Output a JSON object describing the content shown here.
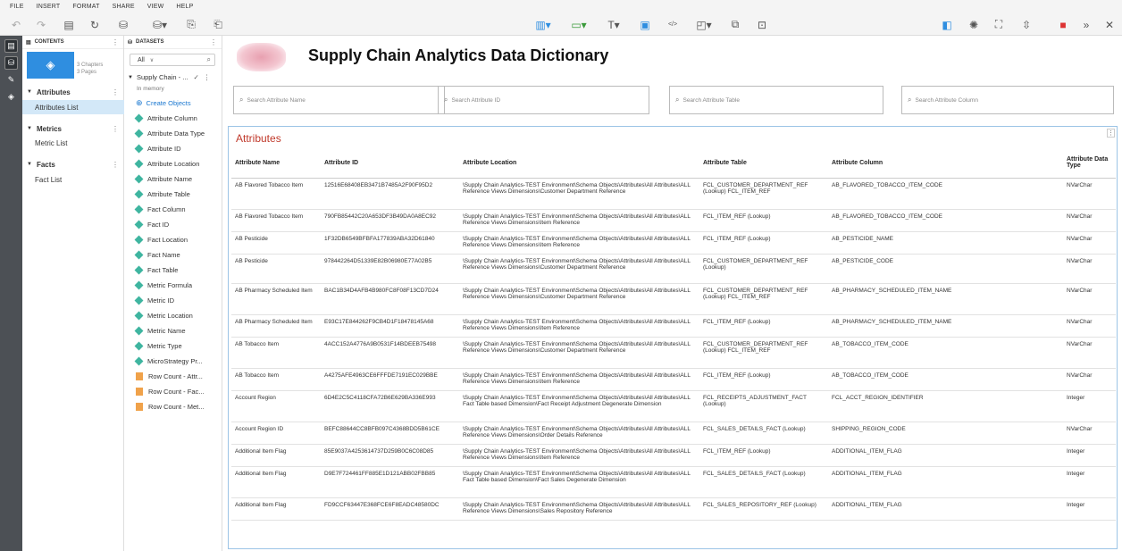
{
  "menu": [
    "FILE",
    "INSERT",
    "FORMAT",
    "SHARE",
    "VIEW",
    "HELP"
  ],
  "contents": {
    "header": "CONTENTS",
    "chapters_count": "3 Chapters",
    "pages_count": "3 Pages",
    "chapters": [
      {
        "label": "Attributes",
        "page": "Attributes List"
      },
      {
        "label": "Metrics",
        "page": "Metric List"
      },
      {
        "label": "Facts",
        "page": "Fact List"
      }
    ]
  },
  "datasets": {
    "header": "DATASETS",
    "filter": "All",
    "dataset_name": "Supply Chain - ...",
    "in_memory": "In memory",
    "create_objects": "Create Objects",
    "items": [
      "Attribute Column",
      "Attribute Data Type",
      "Attribute ID",
      "Attribute Location",
      "Attribute Name",
      "Attribute Table",
      "Fact Column",
      "Fact ID",
      "Fact Location",
      "Fact Name",
      "Fact Table",
      "Metric Formula",
      "Metric ID",
      "Metric Location",
      "Metric Name",
      "Metric Type",
      "MicroStrategy Pr..."
    ],
    "metric_items": [
      "Row Count - Attr...",
      "Row Count - Fac...",
      "Row Count - Met..."
    ]
  },
  "page": {
    "title": "Supply Chain Analytics Data Dictionary",
    "searches": [
      "Search Attribute Name",
      "Search Attribute ID",
      "Search Attribute Table",
      "Search Attribute Column"
    ]
  },
  "grid": {
    "title": "Attributes",
    "columns": [
      "Attribute Name",
      "Attribute ID",
      "Attribute Location",
      "Attribute Table",
      "Attribute Column",
      "Attribute Data Type"
    ],
    "rows": [
      [
        "AB Flavored Tobacco Item",
        "12516E68408EB3471B7485A2F90F95D2",
        "\\Supply Chain Analytics-TEST Environment\\Schema Objects\\Attributes\\All Attributes\\ALL Reference Views Dimensions\\Customer Department Reference",
        "FCL_CUSTOMER_DEPARTMENT_REF (Lookup) FCL_ITEM_REF",
        "AB_FLAVORED_TOBACCO_ITEM_CODE",
        "NVarChar"
      ],
      [
        "AB Flavored Tobacco Item",
        "790FB85442C20A653DF3B49DA0A8EC92",
        "\\Supply Chain Analytics-TEST Environment\\Schema Objects\\Attributes\\All Attributes\\ALL Reference Views Dimensions\\Item Reference",
        "FCL_ITEM_REF (Lookup)",
        "AB_FLAVORED_TOBACCO_ITEM_CODE",
        "NVarChar"
      ],
      [
        "AB Pesticide",
        "1F32DB6549BFBFA177839ABA32D61840",
        "\\Supply Chain Analytics-TEST Environment\\Schema Objects\\Attributes\\All Attributes\\ALL Reference Views Dimensions\\Item Reference",
        "FCL_ITEM_REF (Lookup)",
        "AB_PESTICIDE_NAME",
        "NVarChar"
      ],
      [
        "AB Pesticide",
        "978442264D51339E82B06980E77A02B5",
        "\\Supply Chain Analytics-TEST Environment\\Schema Objects\\Attributes\\All Attributes\\ALL Reference Views Dimensions\\Customer Department Reference",
        "FCL_CUSTOMER_DEPARTMENT_REF (Lookup)",
        "AB_PESTICIDE_CODE",
        "NVarChar"
      ],
      [
        "AB Pharmacy Scheduled Item",
        "BAC1B34D4AFB4B980FC8F08F13CD7D24",
        "\\Supply Chain Analytics-TEST Environment\\Schema Objects\\Attributes\\All Attributes\\ALL Reference Views Dimensions\\Customer Department Reference",
        "FCL_CUSTOMER_DEPARTMENT_REF (Lookup) FCL_ITEM_REF",
        "AB_PHARMACY_SCHEDULED_ITEM_NAME",
        "NVarChar"
      ],
      [
        "AB Pharmacy Scheduled Item",
        "E93C17E844262F9CB4D1F18478145A68",
        "\\Supply Chain Analytics-TEST Environment\\Schema Objects\\Attributes\\All Attributes\\ALL Reference Views Dimensions\\Item Reference",
        "FCL_ITEM_REF (Lookup)",
        "AB_PHARMACY_SCHEDULED_ITEM_NAME",
        "NVarChar"
      ],
      [
        "AB Tobacco Item",
        "4ACC152A4776A9B0531F14BDEEB75498",
        "\\Supply Chain Analytics-TEST Environment\\Schema Objects\\Attributes\\All Attributes\\ALL Reference Views Dimensions\\Customer Department Reference",
        "FCL_CUSTOMER_DEPARTMENT_REF (Lookup) FCL_ITEM_REF",
        "AB_TOBACCO_ITEM_CODE",
        "NVarChar"
      ],
      [
        "AB Tobacco Item",
        "A4275AFE4963CE6FFFDE7191EC029BBE",
        "\\Supply Chain Analytics-TEST Environment\\Schema Objects\\Attributes\\All Attributes\\ALL Reference Views Dimensions\\Item Reference",
        "FCL_ITEM_REF (Lookup)",
        "AB_TOBACCO_ITEM_CODE",
        "NVarChar"
      ],
      [
        "Account Region",
        "6D4E2C5C4118CFA72B6E629BA336E993",
        "\\Supply Chain Analytics-TEST Environment\\Schema Objects\\Attributes\\All Attributes\\ALL Fact Table based Dimension\\Fact Receipt Adjustment Degenerate Dimension",
        "FCL_RECEIPTS_ADJUSTMENT_FACT (Lookup)",
        "FCL_ACCT_REGION_IDENTIFIER",
        "Integer"
      ],
      [
        "Account Region ID",
        "BEFC88644CC8BFB097C4368BDD5B61CE",
        "\\Supply Chain Analytics-TEST Environment\\Schema Objects\\Attributes\\All Attributes\\ALL Reference Views Dimensions\\Order Details Reference",
        "FCL_SALES_DETAILS_FACT (Lookup)",
        "SHIPPING_REGION_CODE",
        "NVarChar"
      ],
      [
        "Additional Item Flag",
        "85E9037A4253614737D259B0C6C08D85",
        "\\Supply Chain Analytics-TEST Environment\\Schema Objects\\Attributes\\All Attributes\\ALL Reference Views Dimensions\\Item Reference",
        "FCL_ITEM_REF (Lookup)",
        "ADDITIONAL_ITEM_FLAG",
        "Integer"
      ],
      [
        "Additional Item Flag",
        "D9E7F724461FF885E1D121ABB02FBB85",
        "\\Supply Chain Analytics-TEST Environment\\Schema Objects\\Attributes\\All Attributes\\ALL Fact Table based Dimension\\Fact Sales Degenerate Dimension",
        "FCL_SALES_DETAILS_FACT (Lookup)",
        "ADDITIONAL_ITEM_FLAG",
        "Integer"
      ],
      [
        "Additional Item Flag",
        "FD9CCF63447E368FCE6F8EADC48580DC",
        "\\Supply Chain Analytics-TEST Environment\\Schema Objects\\Attributes\\All Attributes\\ALL Reference Views Dimensions\\Sales Repository Reference",
        "FCL_SALES_REPOSITORY_REF (Lookup)",
        "ADDITIONAL_ITEM_FLAG",
        "Integer"
      ]
    ]
  },
  "icons": {
    "undo": "undo-icon",
    "redo": "redo-icon",
    "save": "save-icon",
    "refresh": "refresh-icon",
    "accent": "#2f8ee0",
    "title_red": "#c0392b",
    "selected_bg": "#d3e8f8",
    "dataset_attr": "#3fb5a0",
    "dataset_metric": "#f0a24a"
  }
}
